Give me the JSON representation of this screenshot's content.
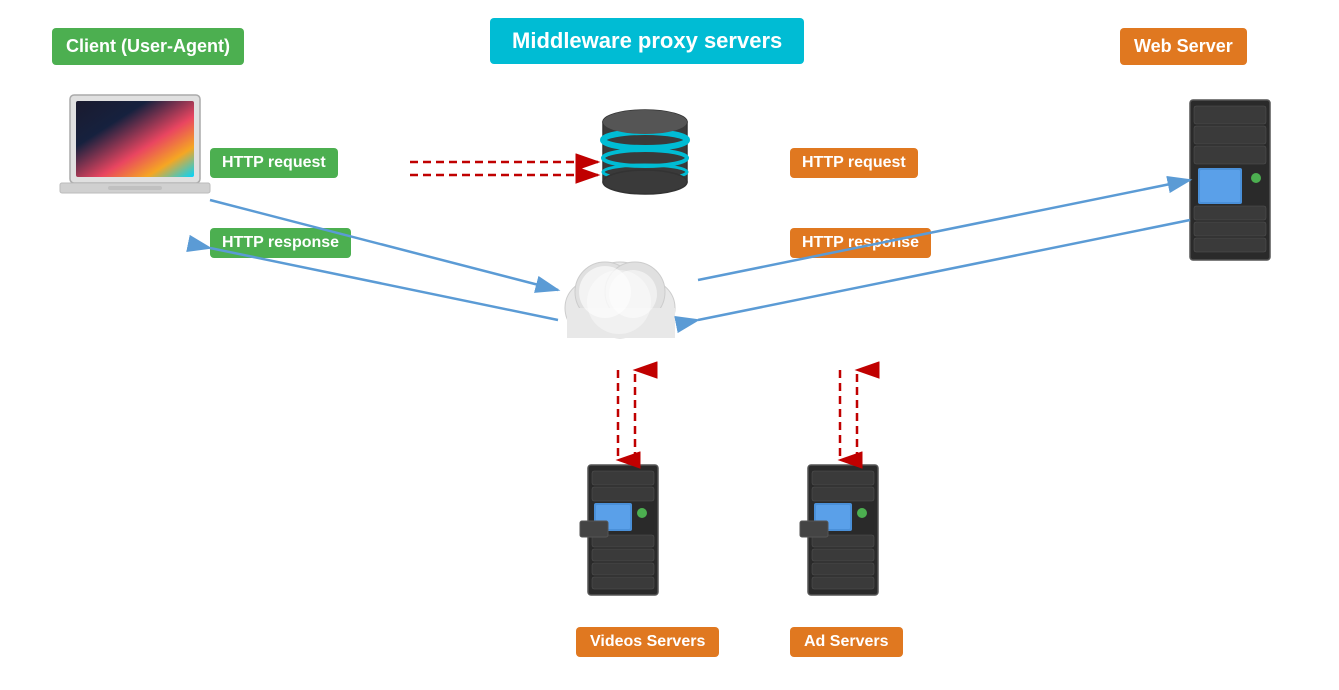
{
  "labels": {
    "client": "Client (User-Agent)",
    "middleware": "Middleware proxy servers",
    "webserver": "Web Server",
    "http_request_left": "HTTP request",
    "http_response_left": "HTTP response",
    "http_request_right": "HTTP request",
    "http_response_right": "HTTP response",
    "videos_servers": "Videos Servers",
    "ad_servers": "Ad Servers"
  },
  "colors": {
    "green": "#4CAF50",
    "orange": "#E07820",
    "cyan": "#00BCD4",
    "arrow_blue": "#5B9BD5",
    "arrow_red": "#C00000",
    "white": "#ffffff"
  }
}
